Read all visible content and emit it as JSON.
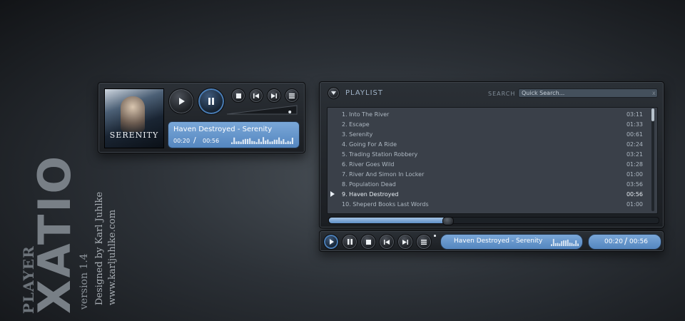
{
  "brand": {
    "player": "PLAYER",
    "name": "XATIO",
    "version": "version 1.4",
    "designer": "Designed by Karl Juhlke",
    "url": "www.karljuhlke.com"
  },
  "mini_player": {
    "album_title": "SERENITY",
    "now_playing": "Haven Destroyed - Serenity",
    "elapsed": "00:20",
    "separator": "/",
    "total": "00:56",
    "volume": 0.9
  },
  "playlist": {
    "title": "PLAYLIST",
    "search_label": "SEARCH",
    "search_placeholder": "Quick Search...",
    "clear": "x",
    "tracks": [
      {
        "title": "1. Into The River",
        "duration": "03:11"
      },
      {
        "title": "2. Escape",
        "duration": "01:33"
      },
      {
        "title": "3. Serenity",
        "duration": "00:61"
      },
      {
        "title": "4. Going For A Ride",
        "duration": "02:24"
      },
      {
        "title": "5. Trading Station Robbery",
        "duration": "03:21"
      },
      {
        "title": "6. River Goes Wild",
        "duration": "01:28"
      },
      {
        "title": "7. River And Simon In Locker",
        "duration": "01:00"
      },
      {
        "title": "8. Population Dead",
        "duration": "03:56"
      },
      {
        "title": "9. Haven Destroyed",
        "duration": "00:56"
      },
      {
        "title": "10. Sheperd Books Last Words",
        "duration": "01:00"
      }
    ],
    "playing_index": 8,
    "progress": 0.37
  },
  "bottom_bar": {
    "now_playing": "Haven Destroyed - Serenity",
    "elapsed": "00:20",
    "separator": "/",
    "total": "00:56"
  },
  "colors": {
    "accent": "#6a98cf",
    "panel": "#23272c"
  },
  "icons": [
    "play-icon",
    "pause-icon",
    "stop-icon",
    "previous-icon",
    "next-icon",
    "menu-icon",
    "chevron-down-icon"
  ]
}
